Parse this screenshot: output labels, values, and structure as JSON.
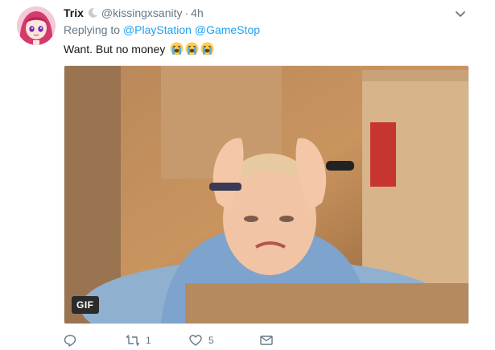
{
  "tweet": {
    "display_name": "Trix",
    "handle": "@kissingxsanity",
    "separator": "·",
    "time": "4h",
    "replying_prefix": "Replying to",
    "mentions": [
      "@PlayStation",
      "@GameStop"
    ],
    "text": "Want. But no money",
    "emoji": [
      "loudly-crying-face",
      "loudly-crying-face",
      "loudly-crying-face"
    ],
    "media_badge": "GIF"
  },
  "actions": {
    "reply_count": "",
    "retweet_count": "1",
    "like_count": "5",
    "dm_count": ""
  },
  "colors": {
    "link": "#1da1f2",
    "muted": "#657786",
    "text": "#14171a"
  }
}
